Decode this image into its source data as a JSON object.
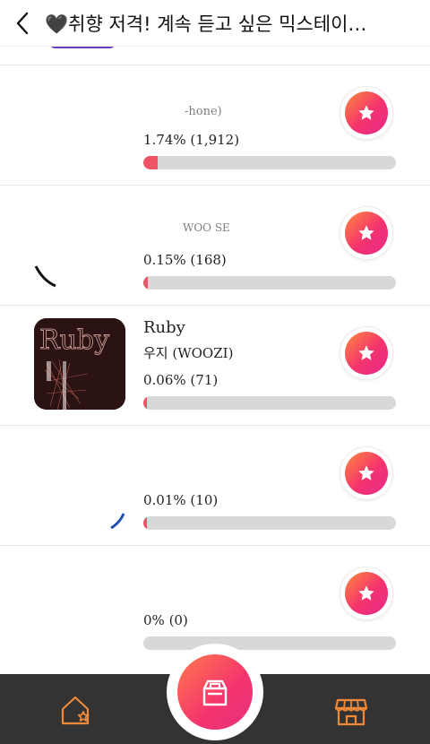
{
  "header": {
    "title": "🖤취향 저격! 계속 듣고 싶은 믹스테이…"
  },
  "rows": [
    {
      "song": "",
      "artist": "-hone)",
      "percent_text": "1.74% (1,912)",
      "share": 0.0174
    },
    {
      "song": "",
      "artist": "WOO SE",
      "percent_text": "0.15% (168)",
      "share": 0.0015
    },
    {
      "song": "Ruby",
      "artist": "우지 (WOOZI)",
      "percent_text": "0.06% (71)",
      "share": 0.0006
    },
    {
      "song": "",
      "artist": "",
      "percent_text": "0.01% (10)",
      "share": 0.0001
    },
    {
      "song": "",
      "artist": "",
      "percent_text": "0% (0)",
      "share": 0
    }
  ],
  "icons": {
    "back": "chevron-left-icon",
    "vote": "star-icon",
    "home": "home-star-icon",
    "center": "ballot-box-icon",
    "store": "store-icon"
  },
  "colors": {
    "accent_start": "#ff8a3d",
    "accent_end": "#e52a8c",
    "bar_fill": "#ef5466",
    "bar_track": "#d8d8d8",
    "nav_bg": "#333333",
    "nav_icon": "#f08a3a"
  }
}
